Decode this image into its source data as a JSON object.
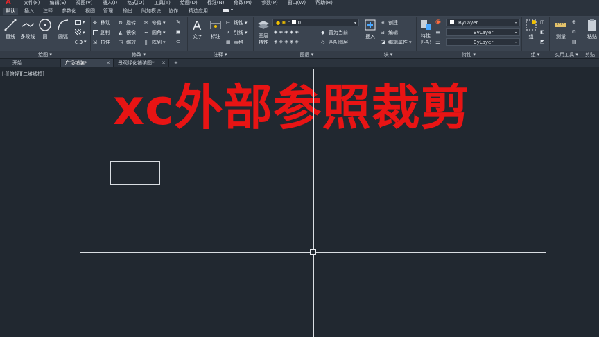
{
  "menubar": {
    "items": [
      "文件(F)",
      "编辑(E)",
      "视图(V)",
      "插入(I)",
      "格式(O)",
      "工具(T)",
      "绘图(D)",
      "标注(N)",
      "修改(M)",
      "参数(P)",
      "窗口(W)",
      "帮助(H)"
    ]
  },
  "ribbon_tabs": [
    "默认",
    "插入",
    "注释",
    "参数化",
    "视图",
    "管理",
    "输出",
    "附加模块",
    "协作",
    "精选应用"
  ],
  "active_ribbon_tab": "默认",
  "draw_panel": {
    "title": "绘图",
    "line": "直线",
    "polyline": "多段线",
    "circle": "圆",
    "arc": "圆弧"
  },
  "modify_panel": {
    "title": "修改",
    "move": "移动",
    "rotate": "旋转",
    "trim": "修剪",
    "copy": "复制",
    "mirror": "镜像",
    "fillet": "圆角",
    "stretch": "拉伸",
    "scale": "缩放",
    "array": "阵列"
  },
  "annotation_panel": {
    "title": "注释",
    "text": "文字",
    "dimension": "标注",
    "linear": "线性",
    "leader": "引线",
    "table": "表格"
  },
  "layers_panel": {
    "title": "图层",
    "properties": "图层特性",
    "layer_value": "0",
    "make_current": "置为当前",
    "match_layer": "匹配图层"
  },
  "block_panel": {
    "title": "块",
    "insert": "插入",
    "create": "创建",
    "edit": "编辑",
    "edit_attributes": "编辑属性"
  },
  "properties_panel": {
    "title": "特性",
    "match": "特性匹配",
    "color": "ByLayer",
    "linetype": "ByLayer",
    "lineweight": "ByLayer"
  },
  "groups_panel": {
    "title": "组",
    "group": "组"
  },
  "utilities_panel": {
    "title": "实用工具",
    "measure": "测量"
  },
  "clipboard_panel": {
    "title": "剪贴",
    "paste": "粘贴"
  },
  "doc_tabs": [
    {
      "label": "开始",
      "active": false
    },
    {
      "label": "广场铺装*",
      "active": true
    },
    {
      "label": "景观绿化铺装图*",
      "active": false
    }
  ],
  "viewport_label": "[-][俯视][二维线框]",
  "overlay_title": "xc外部参照裁剪",
  "colors": {
    "overlay_red": "#e81414",
    "canvas_bg": "#212830",
    "ribbon_bg": "#3b4450"
  }
}
